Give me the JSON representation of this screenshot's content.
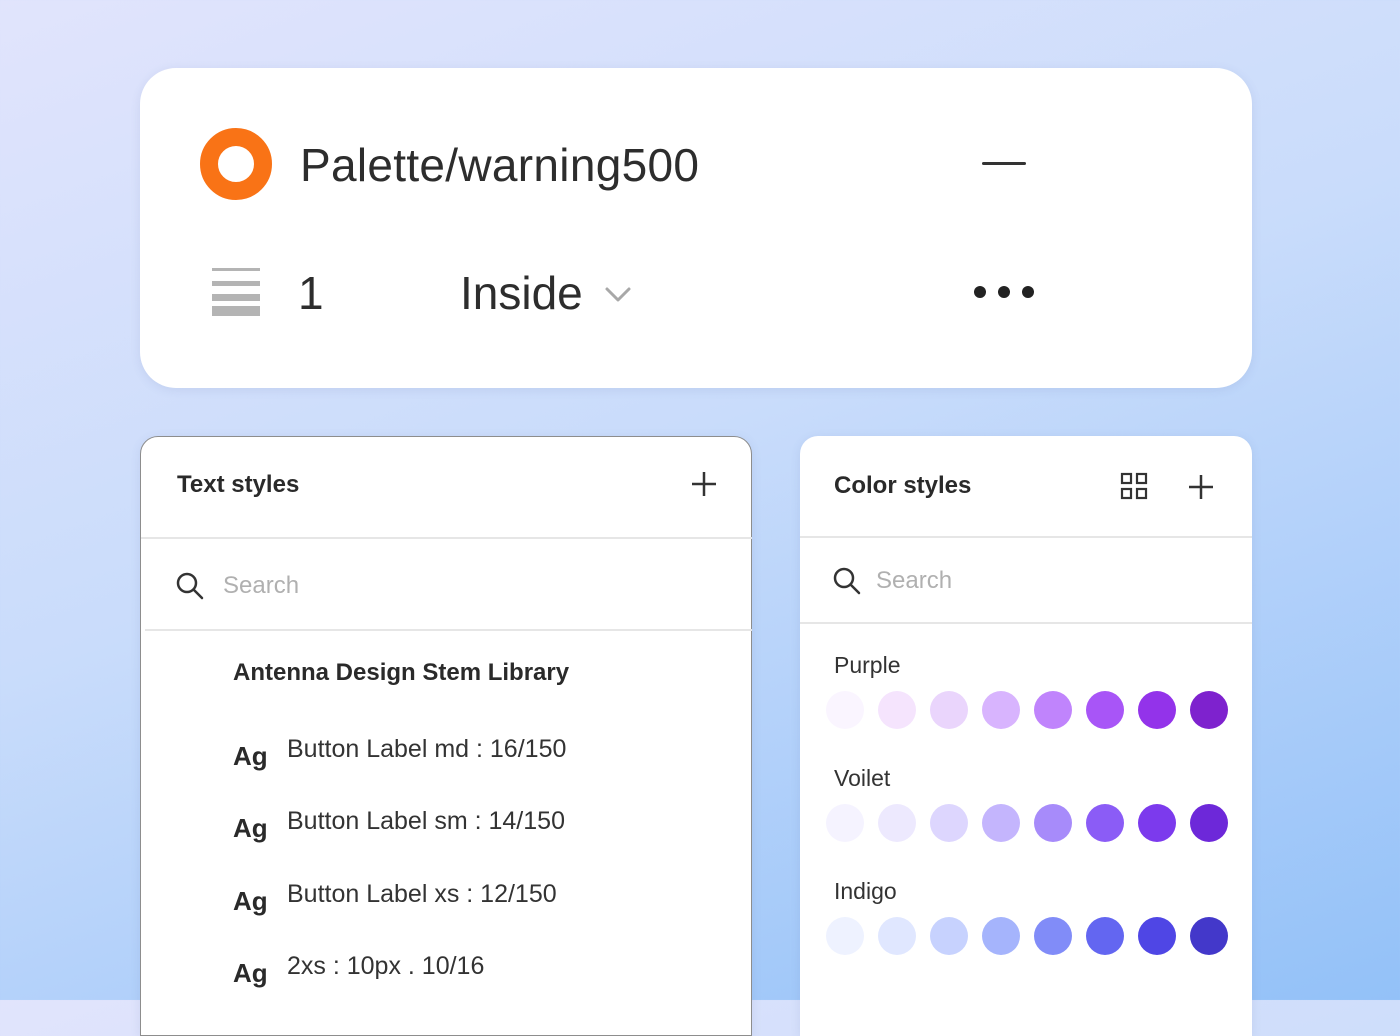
{
  "stroke": {
    "style_name": "Palette/warning500",
    "color": "#f97316",
    "weight": "1",
    "align": "Inside",
    "icons": {
      "style": "ring-color-icon",
      "remove": "minus-icon",
      "weight": "stroke-weight-icon",
      "dropdown": "chevron-down-icon",
      "more": "more-dots-icon"
    }
  },
  "text_styles": {
    "title": "Text styles",
    "search_placeholder": "Search",
    "library_name": "Antenna Design Stem Library",
    "sample_glyph": "Ag",
    "items": [
      {
        "label": "Button Label md : 16/150"
      },
      {
        "label": "Button Label sm : 14/150"
      },
      {
        "label": "Button Label xs : 12/150"
      },
      {
        "label": "2xs : 10px . 10/16"
      }
    ]
  },
  "color_styles": {
    "title": "Color styles",
    "search_placeholder": "Search",
    "groups": [
      {
        "name": "Purple",
        "swatches": [
          "#faf5ff",
          "#f5e4fd",
          "#ead5fc",
          "#d8b4fe",
          "#c084fc",
          "#a855f7",
          "#9333ea",
          "#7e22ce"
        ]
      },
      {
        "name": "Voilet",
        "swatches": [
          "#f5f3ff",
          "#ede9fe",
          "#ddd6fe",
          "#c4b5fd",
          "#a78bfa",
          "#8b5cf6",
          "#7c3aed",
          "#6d28d9"
        ]
      },
      {
        "name": "Indigo",
        "swatches": [
          "#eef2ff",
          "#e0e7ff",
          "#c7d2fe",
          "#a5b4fc",
          "#818cf8",
          "#6366f1",
          "#4f46e5",
          "#4338ca"
        ]
      }
    ]
  }
}
